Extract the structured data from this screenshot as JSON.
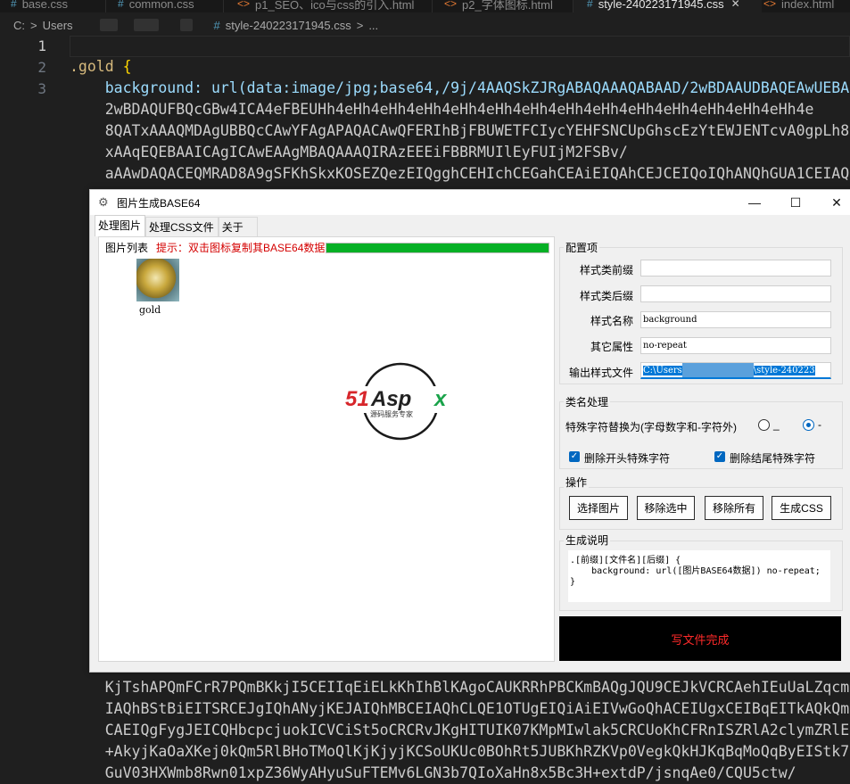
{
  "editor": {
    "tabs": [
      {
        "label": "base.css",
        "icon": "css-hash-icon",
        "active": false
      },
      {
        "label": "common.css",
        "icon": "css-hash-icon",
        "active": false
      },
      {
        "label": "p1_SEO、ico与css的引入.html",
        "icon": "html-icon",
        "active": false
      },
      {
        "label": "p2_字体图标.html",
        "icon": "html-icon",
        "active": false
      },
      {
        "label": "style-240223171945.css",
        "icon": "css-hash-icon",
        "active": true
      },
      {
        "label": "index.html",
        "icon": "html-icon",
        "active": false
      }
    ],
    "breadcrumb": {
      "drive": "C:",
      "sep1": ">",
      "users": "Users",
      "sep2": ">",
      "hash": "#",
      "file": "style-240223171945.css",
      "sep3": ">",
      "more": "..."
    },
    "gutter": [
      "1",
      "2",
      "3"
    ],
    "lines": [
      "",
      ".gold {",
      "    background: url(data:image/jpg;base64,/9j/4AAQSkZJRgABAQAAAQABAAD/2wBDAAUDBAQEAwUEBA",
      "    2wBDAQUFBQcGBw4ICA4eFBEUHh4eHh4eHh4eHh4eHh4eHh4eHh4eHh4eHh4eHh4eHh4eHh4eHh4eHh4e",
      "    8QATxAAAQMDAgUBBQcCAwYFAgAPAQACAwQFERIhBjFBUWETFCIycYEHFSNCUpGhscEzYtEWJENTcvA0gpLh8",
      "    xAAqEQEBAAICAgICAwEAAgMBAQAAAQIRAzEEEiFBBRMUIlEyFUIjM2FSBv/",
      "    aAAwDAQACEQMRAD8A9gSFKhSkxKOSEZQezEIQgghCEHIchCEGahCEAiEIQAhCEJCEIQoIQhANQhGUA1CEIAQ"
    ],
    "lines_bottom": [
      "    KjTshAPQmFCrR7PQmBKkjI5CEIIqEiELkKhIhBlKAgoCAUKRRhPBCKmBAQgJQU9CEJkVCRCAehIEuUaLZqcm",
      "    IAQhBStBiEITSRCEJgIQhANyjKEJAIQhMBCEIAQhCLQE1OTUgEIQiAiEIVwGoQhACEIUgxCEIBqEITkAQkQm",
      "    CAEIQgFygJEICQHbcpcjuokICVCiSt5oCRCRvJKgHITUIK07KMpMIwlak5CRCUoKhCFRnISZRlA2clymZRlE",
      "    +AkyjKaOaXKej0kQm5RlBHoTMoQlKjKjyjKCSoUKUc0BOhRt5JUBKhRZKVp0VegkQkHJKqBqMoQqByEIStk7",
      "    GuV03HXWmb8Rwn01xpZ36WyAHyuSuFTEMv6LGN3b7QIoXaHn8x5Bc3H+extdP/jsnqAe0/CQU5ctw/"
    ]
  },
  "dialog": {
    "title": "图片生成BASE64",
    "app_icon": "gear-icon",
    "window_buttons": {
      "minimize": "—",
      "maximize": "☐",
      "close": "✕"
    },
    "tabs": [
      "处理图片",
      "处理CSS文件",
      "关于"
    ],
    "active_tab": 0,
    "left_panel": {
      "label": "图片列表",
      "hint": "提示：双击图标复制其BASE64数据",
      "progress": 1.0,
      "images": [
        {
          "name": "gold"
        }
      ],
      "logo": {
        "text": "51Aspx",
        "subtitle": "源码服务专家"
      }
    },
    "config": {
      "group_label": "配置项",
      "fields": [
        {
          "label": "样式类前缀",
          "value": ""
        },
        {
          "label": "样式类后缀",
          "value": ""
        },
        {
          "label": "样式名称",
          "value": "background"
        },
        {
          "label": "其它属性",
          "value": "no-repeat"
        },
        {
          "label": "输出样式文件",
          "value_start": "C:\\Users",
          "value_end": "\\style-240223"
        }
      ]
    },
    "classname": {
      "group_label": "类名处理",
      "replace_label": "特殊字符替换为(字母数字和-字符外)",
      "radio_options": [
        "_",
        "-"
      ],
      "selected_radio": 1,
      "checkboxes": [
        {
          "label": "删除开头特殊字符",
          "checked": true
        },
        {
          "label": "删除结尾特殊字符",
          "checked": true
        }
      ]
    },
    "actions": {
      "group_label": "操作",
      "buttons": [
        "选择图片",
        "移除选中",
        "移除所有",
        "生成CSS"
      ]
    },
    "description": {
      "group_label": "生成说明",
      "text": ".[前缀][文件名][后缀] {\n    background: url([图片BASE64数据]) no-repeat;\n}"
    },
    "status": "写文件完成"
  },
  "colors": {
    "editor_bg": "#1f1f1f",
    "selector": "#d7ba7d",
    "brace": "#ffd700",
    "property": "#9cdcfe",
    "hint_red": "#d40000",
    "progress_green": "#06b025",
    "status_bg": "#000000",
    "status_text": "#ff2a2a",
    "accent_blue": "#0078d7"
  }
}
